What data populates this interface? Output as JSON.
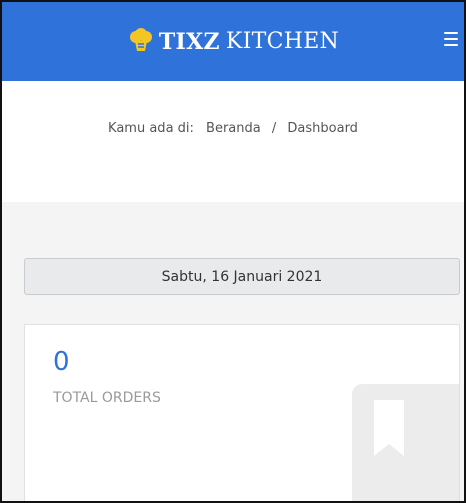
{
  "header": {
    "brand_part1": "TIXZ",
    "brand_part2": "KITCHEN",
    "logo_icon": "chef-hat-icon",
    "menu_icon": "hamburger-menu-icon",
    "bg_color": "#2f72d9"
  },
  "breadcrumb": {
    "prefix": "Kamu ada di:",
    "items": [
      "Beranda",
      "Dashboard"
    ],
    "separator": "/"
  },
  "date": {
    "text": "Sabtu, 16 Januari 2021"
  },
  "card": {
    "count": "0",
    "label": "TOTAL ORDERS",
    "icon": "bookmark-icon",
    "accent_color": "#2f72d9"
  }
}
